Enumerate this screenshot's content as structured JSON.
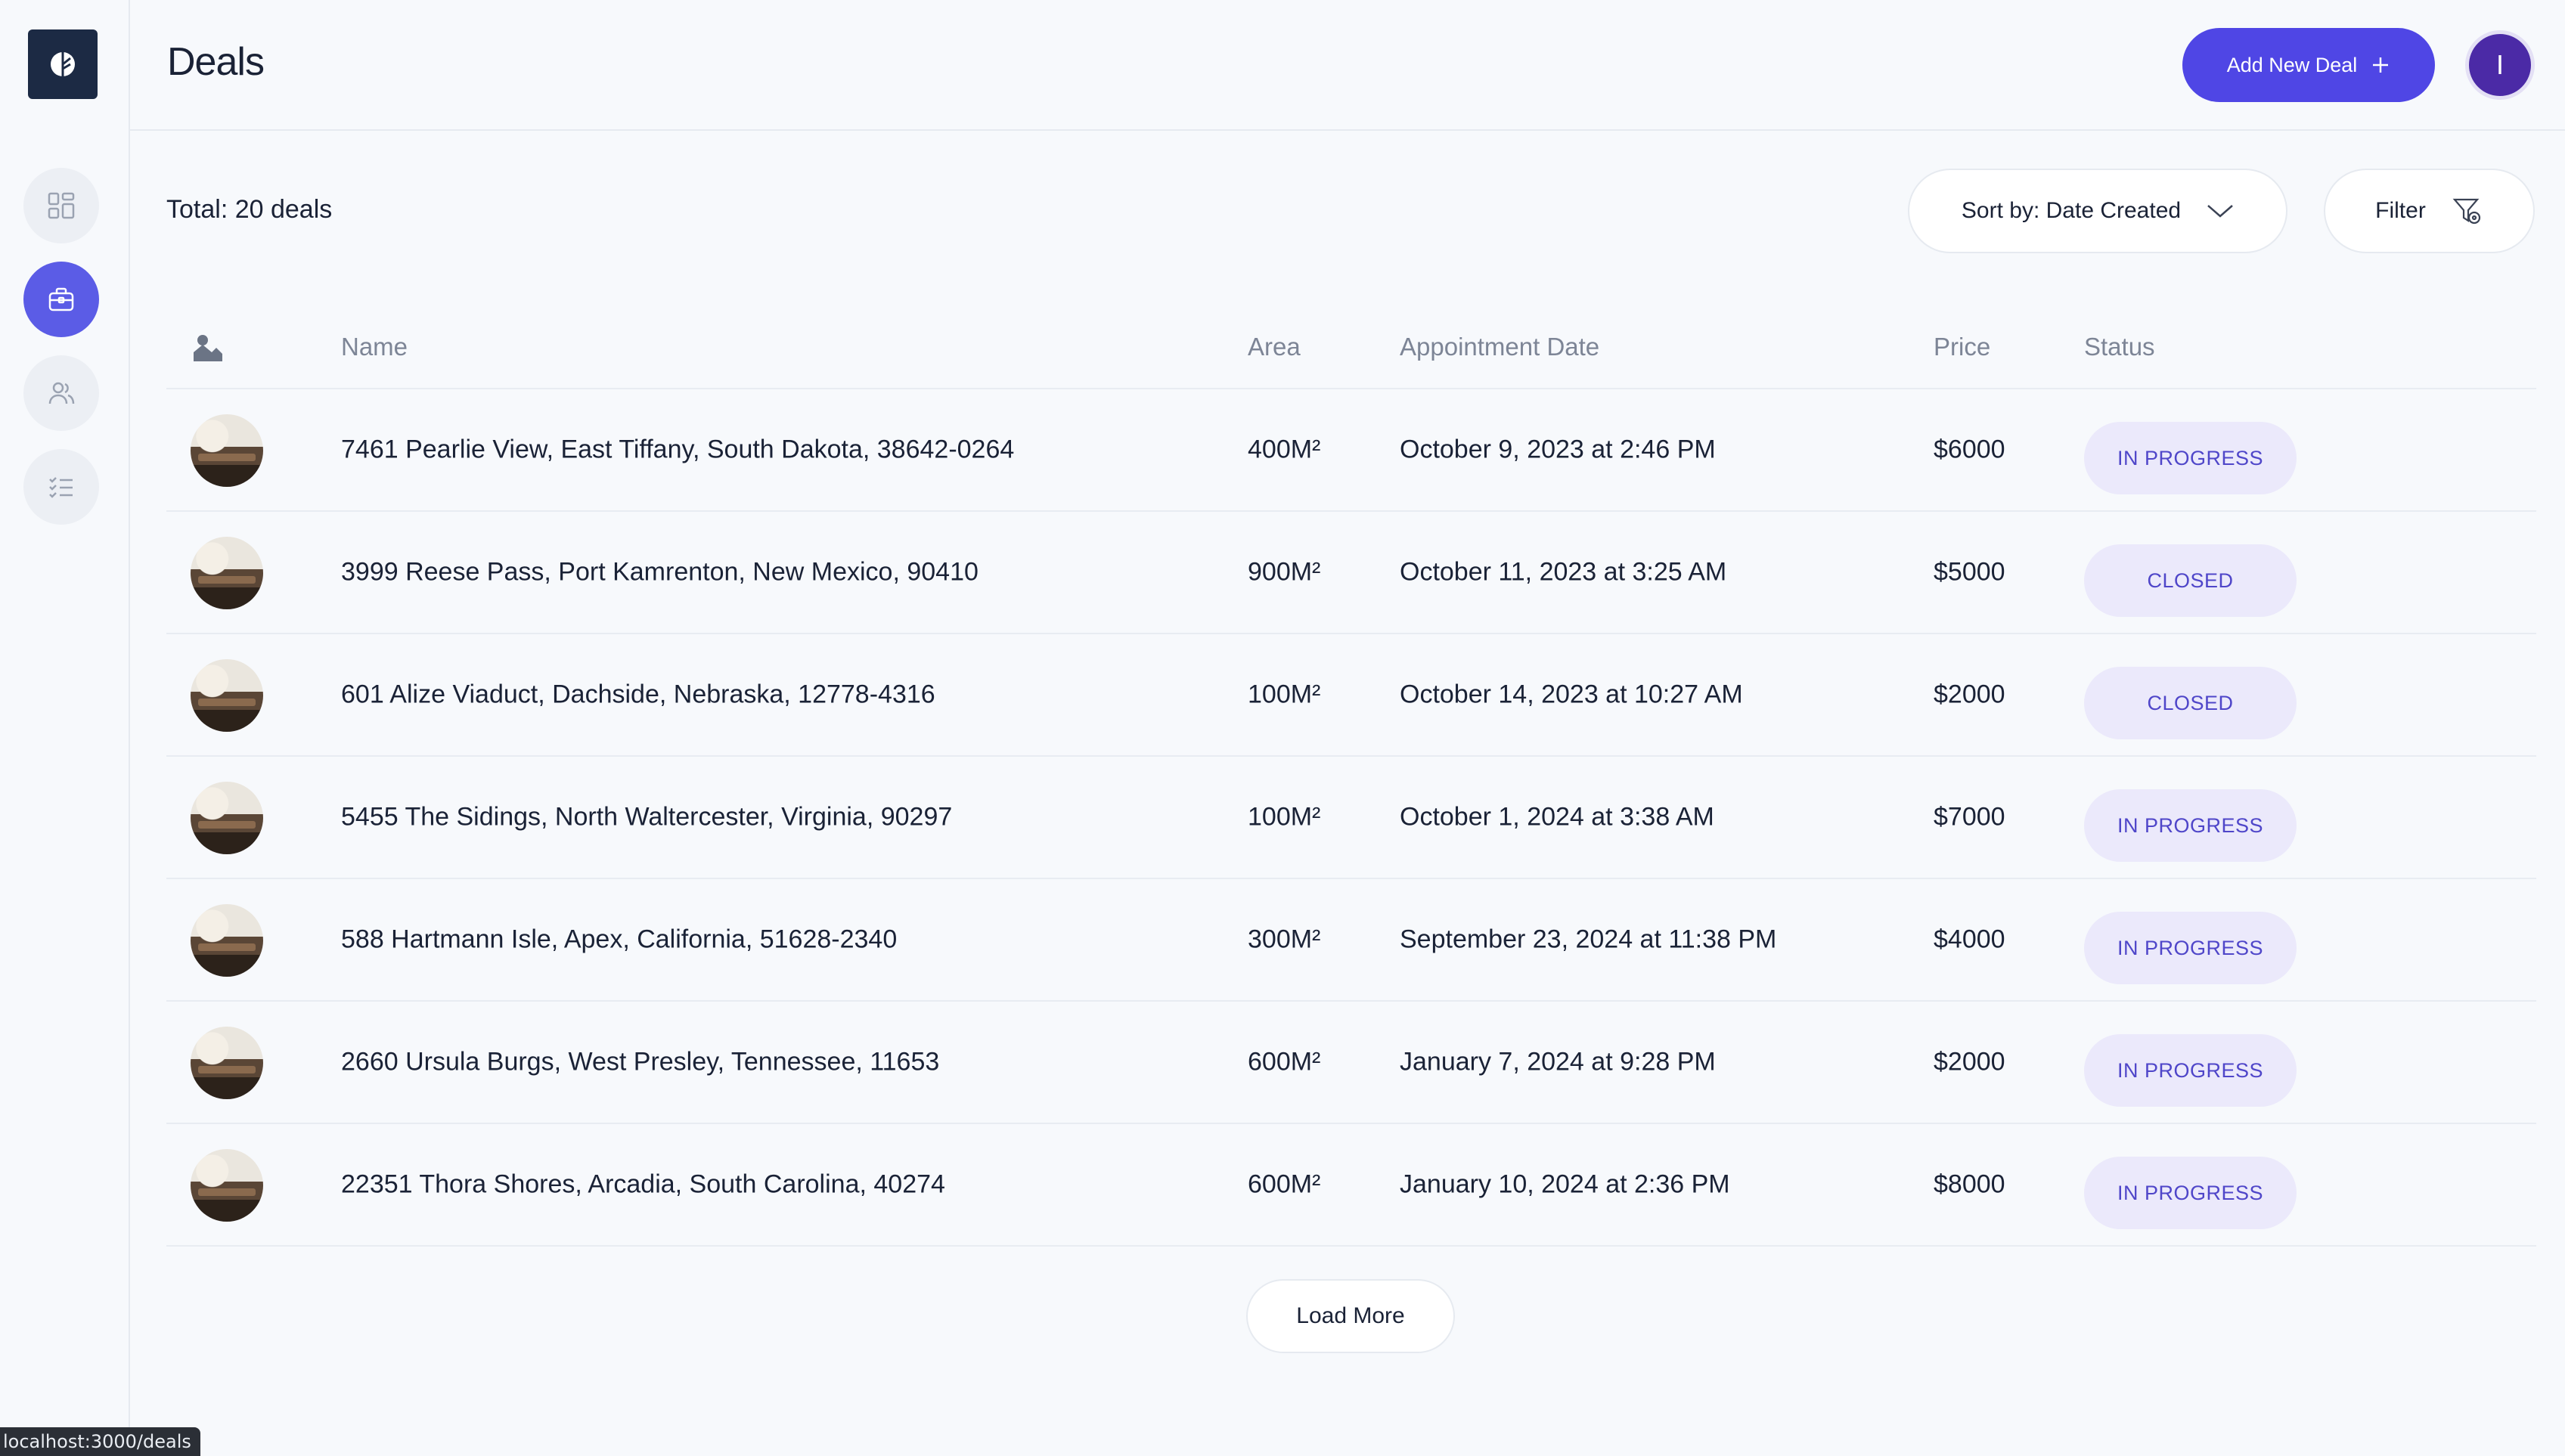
{
  "header": {
    "title": "Deals",
    "add_button_label": "Add New Deal",
    "avatar_initial": "I"
  },
  "sidebar": {
    "items": [
      {
        "name": "dashboard",
        "icon": "grid-icon",
        "active": false
      },
      {
        "name": "deals",
        "icon": "briefcase-icon",
        "active": true
      },
      {
        "name": "customers",
        "icon": "users-icon",
        "active": false
      },
      {
        "name": "tasks",
        "icon": "checklist-icon",
        "active": false
      }
    ]
  },
  "toolbar": {
    "total_label": "Total: 20 deals",
    "sort_label": "Sort by: Date Created",
    "filter_label": "Filter"
  },
  "table": {
    "columns": [
      "Name",
      "Area",
      "Appointment Date",
      "Price",
      "Status"
    ],
    "rows": [
      {
        "name": "7461 Pearlie View, East Tiffany, South Dakota, 38642-0264",
        "area": "400M²",
        "date": "October 9, 2023 at 2:46 PM",
        "price": "$6000",
        "status": "IN PROGRESS"
      },
      {
        "name": "3999 Reese Pass, Port Kamrenton, New Mexico, 90410",
        "area": "900M²",
        "date": "October 11, 2023 at 3:25 AM",
        "price": "$5000",
        "status": "CLOSED"
      },
      {
        "name": "601 Alize Viaduct, Dachside, Nebraska, 12778-4316",
        "area": "100M²",
        "date": "October 14, 2023 at 10:27 AM",
        "price": "$2000",
        "status": "CLOSED"
      },
      {
        "name": "5455 The Sidings, North Waltercester, Virginia, 90297",
        "area": "100M²",
        "date": "October 1, 2024 at 3:38 AM",
        "price": "$7000",
        "status": "IN PROGRESS"
      },
      {
        "name": "588 Hartmann Isle, Apex, California, 51628-2340",
        "area": "300M²",
        "date": "September 23, 2024 at 11:38 PM",
        "price": "$4000",
        "status": "IN PROGRESS"
      },
      {
        "name": "2660 Ursula Burgs, West Presley, Tennessee, 11653",
        "area": "600M²",
        "date": "January 7, 2024 at 9:28 PM",
        "price": "$2000",
        "status": "IN PROGRESS"
      },
      {
        "name": "22351 Thora Shores, Arcadia, South Carolina, 40274",
        "area": "600M²",
        "date": "January 10, 2024 at 2:36 PM",
        "price": "$8000",
        "status": "IN PROGRESS"
      }
    ]
  },
  "load_more_label": "Load More",
  "status_bar_url": "localhost:3000/deals",
  "colors": {
    "accent": "#4f46e5",
    "badge_bg": "#ebe9fb",
    "badge_text": "#4f46c9",
    "logo_bg": "#1c2a44"
  }
}
